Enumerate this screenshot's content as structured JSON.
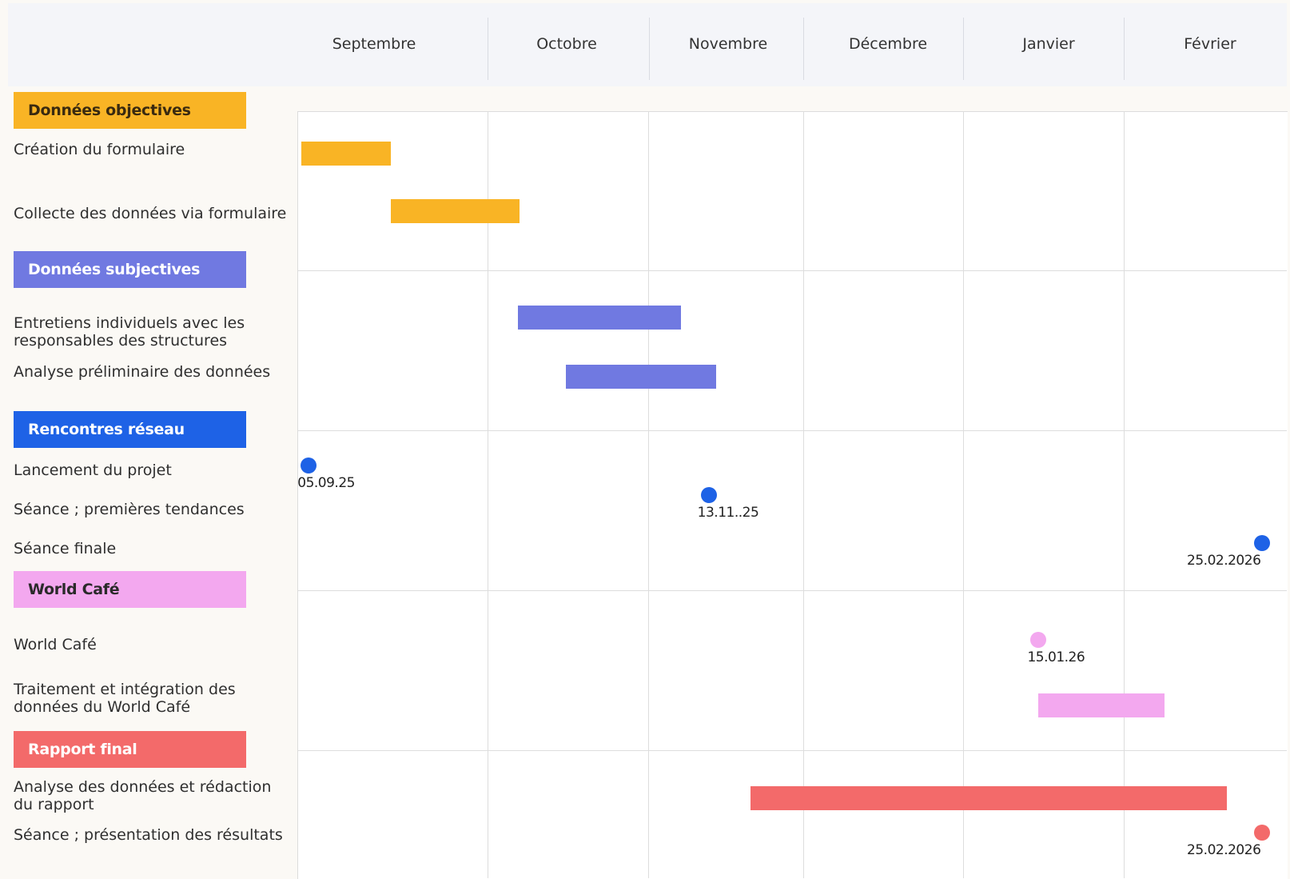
{
  "months": [
    "Septembre",
    "Octobre",
    "Novembre",
    "Décembre",
    "Janvier",
    "Février"
  ],
  "colors": {
    "objective": "#f9b425",
    "subjective": "#7079e1",
    "network": "#1e62e6",
    "worldcafe": "#f3a8ef",
    "report": "#f36a6a"
  },
  "chart_data": {
    "type": "gantt",
    "x_unit": "month",
    "x_range": [
      "Septembre",
      "Février"
    ],
    "groups": [
      {
        "label": "Données objectives",
        "color": "#f9b425",
        "text_color": "#3a2a10",
        "tasks": [
          {
            "label": "Création du formulaire",
            "start": 0.02,
            "end": 0.49
          },
          {
            "label": "Collecte des données via formulaire",
            "start": 0.49,
            "end": 1.2
          }
        ]
      },
      {
        "label": "Données subjectives",
        "color": "#7079e1",
        "text_color": "#ffffff",
        "tasks": [
          {
            "label": "Entretiens individuels avec les responsables des structures",
            "start": 1.19,
            "end": 2.21
          },
          {
            "label": "Analyse préliminaire des données",
            "start": 1.49,
            "end": 2.44
          }
        ]
      },
      {
        "label": "Rencontres réseau",
        "color": "#1e62e6",
        "text_color": "#ffffff",
        "tasks": [
          {
            "label": "Lancement du projet",
            "milestone": 0.06,
            "date": "05.09.25"
          },
          {
            "label": "Séance ; premières tendances",
            "milestone": 2.39,
            "date": "13.11..25"
          },
          {
            "label": "Séance finale",
            "milestone": 5.85,
            "date": "25.02.2026"
          }
        ]
      },
      {
        "label": "World Café",
        "color": "#f3a8ef",
        "text_color": "#2a2a2a",
        "tasks": [
          {
            "label": "World Café",
            "milestone": 4.47,
            "date": "15.01.26"
          },
          {
            "label": "Traitement et intégration des données du World Café",
            "start": 4.47,
            "end": 5.25
          }
        ]
      },
      {
        "label": "Rapport final",
        "color": "#f36a6a",
        "text_color": "#ffffff",
        "tasks": [
          {
            "label": "Analyse des données et rédaction du rapport",
            "start": 2.66,
            "end": 5.63
          },
          {
            "label": "Séance ; présentation des résultats",
            "milestone": 5.85,
            "date": "25.02.2026"
          }
        ]
      }
    ]
  }
}
